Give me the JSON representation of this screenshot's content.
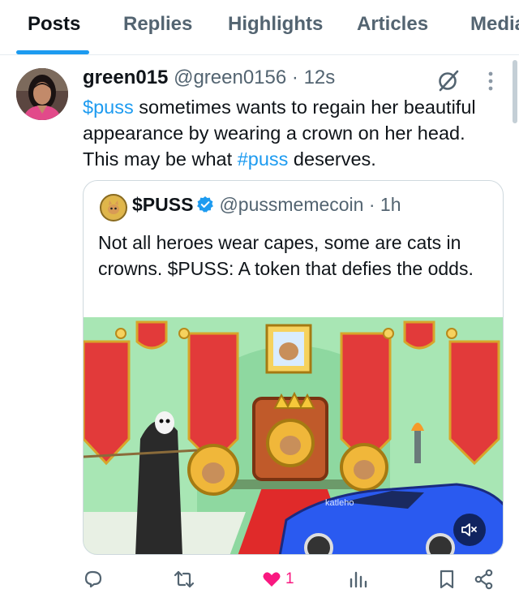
{
  "tabs": [
    {
      "label": "Posts",
      "active": true
    },
    {
      "label": "Replies",
      "active": false
    },
    {
      "label": "Highlights",
      "active": false
    },
    {
      "label": "Articles",
      "active": false
    },
    {
      "label": "Media",
      "active": false
    }
  ],
  "post": {
    "display_name": "green015",
    "handle": "@green0156",
    "time": "12s",
    "text_cashtag": "$puss",
    "text_part1": " sometimes wants to regain her beautiful appearance by wearing a crown on her head. This may be what ",
    "text_hashtag": "#puss",
    "text_part2": " deserves."
  },
  "quote": {
    "display_name": "$PUSS",
    "handle": "@pussmemecoin",
    "time": "1h",
    "text": "Not all heroes wear capes, some are cats in crowns. $PUSS: A token that defies the odds.",
    "media_watermark": "katleho",
    "verified_color": "#1d9bf0"
  },
  "actions": {
    "reply_icon": "reply-icon",
    "repost_icon": "repost-icon",
    "like_icon": "heart-icon",
    "like_count": "1",
    "views_icon": "views-icon",
    "bookmark_icon": "bookmark-icon",
    "share_icon": "share-icon"
  },
  "colors": {
    "accent": "#1d9bf0",
    "like": "#f91880",
    "text": "#0f1419",
    "secondary": "#536471"
  }
}
